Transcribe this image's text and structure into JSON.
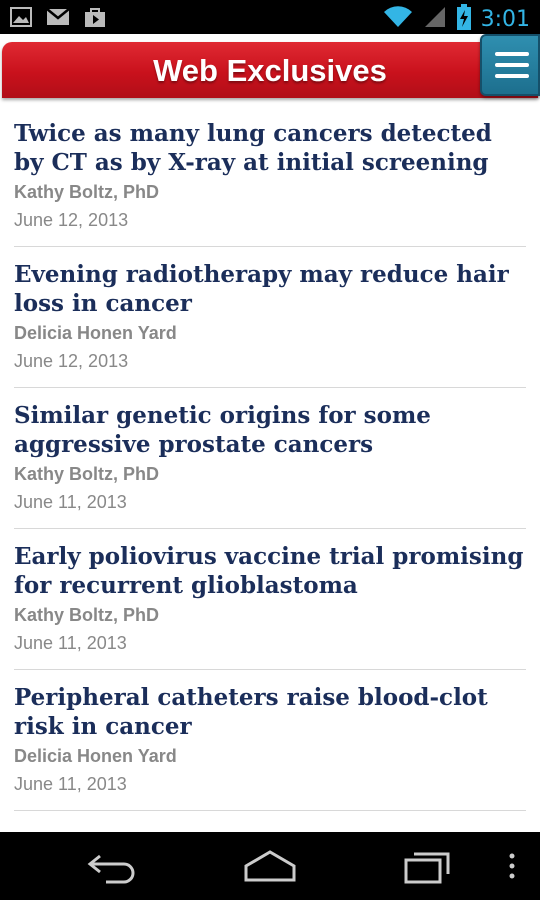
{
  "status_bar": {
    "time": "3:01",
    "left_icons": [
      "image-icon",
      "gmail-icon",
      "play-store-icon"
    ],
    "right_icons": [
      "wifi-icon",
      "signal-icon",
      "battery-charging-icon"
    ]
  },
  "header": {
    "title": "Web Exclusives",
    "menu_icon": "hamburger-menu-icon",
    "brand_color": "#c9111c",
    "menu_color": "#2583a6"
  },
  "articles": [
    {
      "title": "Twice as many lung cancers detected by CT as by X-ray at initial screening",
      "author": "Kathy Boltz, PhD",
      "date": "June 12, 2013"
    },
    {
      "title": "Evening radiotherapy may reduce hair loss in cancer",
      "author": "Delicia Honen Yard",
      "date": "June 12, 2013"
    },
    {
      "title": "Similar genetic origins for some aggressive prostate cancers",
      "author": "Kathy Boltz, PhD",
      "date": "June 11, 2013"
    },
    {
      "title": "Early poliovirus vaccine trial promising for recurrent glioblastoma",
      "author": "Kathy Boltz, PhD",
      "date": "June 11, 2013"
    },
    {
      "title": "Peripheral catheters raise blood-clot risk in cancer",
      "author": "Delicia Honen Yard",
      "date": "June 11, 2013"
    }
  ],
  "nav_bar": {
    "buttons": [
      "back-icon",
      "home-icon",
      "recent-apps-icon",
      "overflow-menu-icon"
    ]
  }
}
